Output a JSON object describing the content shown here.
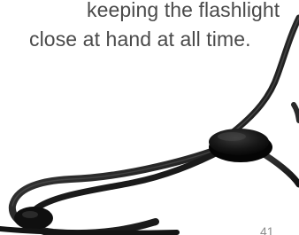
{
  "manual": {
    "body_lines": [
      "keeping the flashlight",
      "close at hand at all time."
    ],
    "page_number": "41"
  },
  "illustration": {
    "subject": "lanyard-cord-with-stopper",
    "cord_color": "#1c1c1c",
    "stopper_color": "#0e0e0e"
  }
}
